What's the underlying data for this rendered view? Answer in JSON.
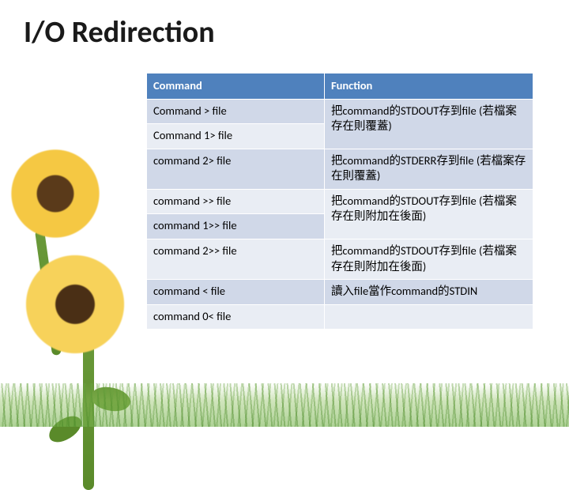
{
  "title": "I/O Redirection",
  "headers": {
    "col1": "Command",
    "col2": "Function"
  },
  "rows": [
    {
      "cmd": "Command > file",
      "func": "把command的STDOUT存到file (若檔案存在則覆蓋)",
      "rs": 2
    },
    {
      "cmd": "Command 1> file"
    },
    {
      "cmd": "command 2> file",
      "func": "把command的STDERR存到file (若檔案存在則覆蓋)"
    },
    {
      "cmd": "command >> file",
      "func": "把command的STDOUT存到file (若檔案存在則附加在後面)",
      "rs": 2
    },
    {
      "cmd": "command 1>> file"
    },
    {
      "cmd": "command 2>> file",
      "func": "把command的STDOUT存到file (若檔案存在則附加在後面)"
    },
    {
      "cmd": "command < file",
      "func": "讀入file當作command的STDIN"
    },
    {
      "cmd": "command 0< file",
      "func": ""
    }
  ]
}
